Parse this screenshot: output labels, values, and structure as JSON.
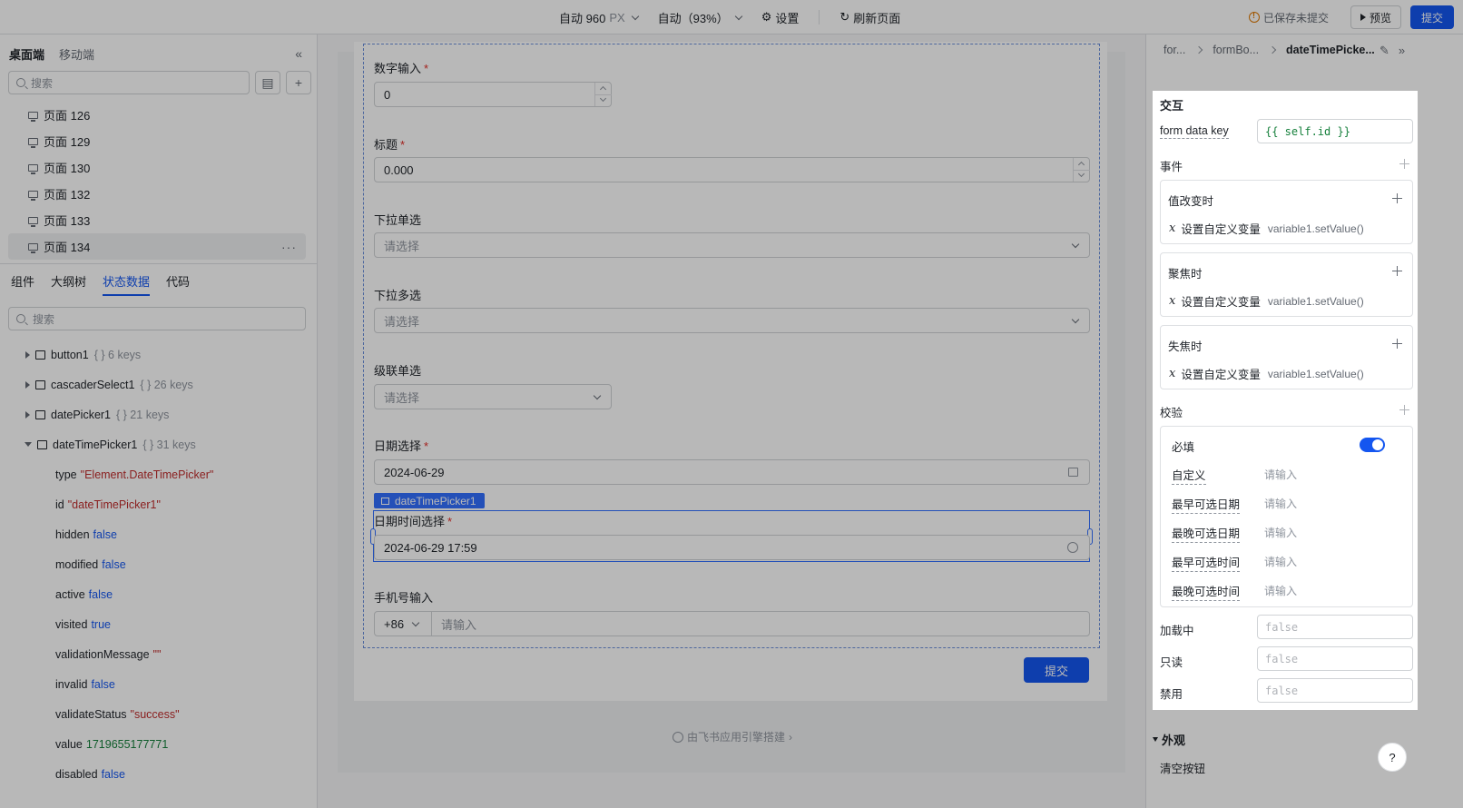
{
  "topbar": {
    "width_label": "自动 960",
    "width_unit": "PX",
    "zoom_label": "自动（93%）",
    "settings_label": "设置",
    "refresh_label": "刷新页面",
    "unsaved_label": "已保存未提交",
    "preview_label": "预览",
    "submit_label": "提交"
  },
  "left": {
    "tabs": [
      "桌面端",
      "移动端"
    ],
    "search_placeholder": "搜索",
    "pages": [
      "页面 126",
      "页面 129",
      "页面 130",
      "页面 132",
      "页面 133",
      "页面 134"
    ],
    "active_page": "页面 134",
    "bottom_tabs": [
      "组件",
      "大纲树",
      "状态数据",
      "代码"
    ],
    "active_bottom_tab": "状态数据",
    "search2_placeholder": "搜索",
    "tree": [
      {
        "name": "button1",
        "keys": "{ } 6 keys",
        "expanded": false
      },
      {
        "name": "cascaderSelect1",
        "keys": "{ } 26 keys",
        "expanded": false
      },
      {
        "name": "datePicker1",
        "keys": "{ } 21 keys",
        "expanded": false
      },
      {
        "name": "dateTimePicker1",
        "keys": "{ } 31 keys",
        "expanded": true
      }
    ],
    "props": [
      {
        "key": "type",
        "value": "\"Element.DateTimePicker\"",
        "kind": "str"
      },
      {
        "key": "id",
        "value": "\"dateTimePicker1\"",
        "kind": "str"
      },
      {
        "key": "hidden",
        "value": "false",
        "kind": "bool"
      },
      {
        "key": "modified",
        "value": "false",
        "kind": "bool"
      },
      {
        "key": "active",
        "value": "false",
        "kind": "bool"
      },
      {
        "key": "visited",
        "value": "true",
        "kind": "bool"
      },
      {
        "key": "validationMessage",
        "value": "\"\"",
        "kind": "str"
      },
      {
        "key": "invalid",
        "value": "false",
        "kind": "bool"
      },
      {
        "key": "validateStatus",
        "value": "\"success\"",
        "kind": "str"
      },
      {
        "key": "value",
        "value": "1719655177771",
        "kind": "num"
      },
      {
        "key": "disabled",
        "value": "false",
        "kind": "bool"
      }
    ]
  },
  "form": {
    "number_label": "数字输入",
    "number_value": "0",
    "title_label": "标题",
    "title_value": "0.000",
    "select_single_label": "下拉单选",
    "select_single_ph": "请选择",
    "select_multi_label": "下拉多选",
    "select_multi_ph": "请选择",
    "cascader_label": "级联单选",
    "cascader_ph": "请选择",
    "date_label": "日期选择",
    "date_value": "2024-06-29",
    "selected_tag": "dateTimePicker1",
    "datetime_label": "日期时间选择",
    "datetime_value": "2024-06-29 17:59",
    "phone_label": "手机号输入",
    "phone_prefix": "+86",
    "phone_ph": "请输入",
    "submit_label": "提交",
    "powered_by": "由飞书应用引擎搭建"
  },
  "right": {
    "crumbs": [
      "for...",
      "formBo...",
      "dateTimePicke..."
    ],
    "interaction_title": "交互",
    "form_data_key_label": "form data key",
    "form_data_key_value": "{{ self.id }}",
    "events_title": "事件",
    "events": [
      {
        "title": "值改变时",
        "action": "设置自定义变量",
        "code": "variable1.setValue()"
      },
      {
        "title": "聚焦时",
        "action": "设置自定义变量",
        "code": "variable1.setValue()"
      },
      {
        "title": "失焦时",
        "action": "设置自定义变量",
        "code": "variable1.setValue()"
      }
    ],
    "validation_title": "校验",
    "required_label": "必填",
    "validation_rows": [
      {
        "label": "自定义",
        "ph": "请输入"
      },
      {
        "label": "最早可选日期",
        "ph": "请输入"
      },
      {
        "label": "最晚可选日期",
        "ph": "请输入"
      },
      {
        "label": "最早可选时间",
        "ph": "请输入"
      },
      {
        "label": "最晚可选时间",
        "ph": "请输入"
      }
    ],
    "loading_label": "加载中",
    "loading_value": "false",
    "readonly_label": "只读",
    "readonly_value": "false",
    "disabled_label": "禁用",
    "disabled_value": "false",
    "appearance_title": "外观",
    "clear_button_label": "清空按钮",
    "help_label": "?"
  }
}
